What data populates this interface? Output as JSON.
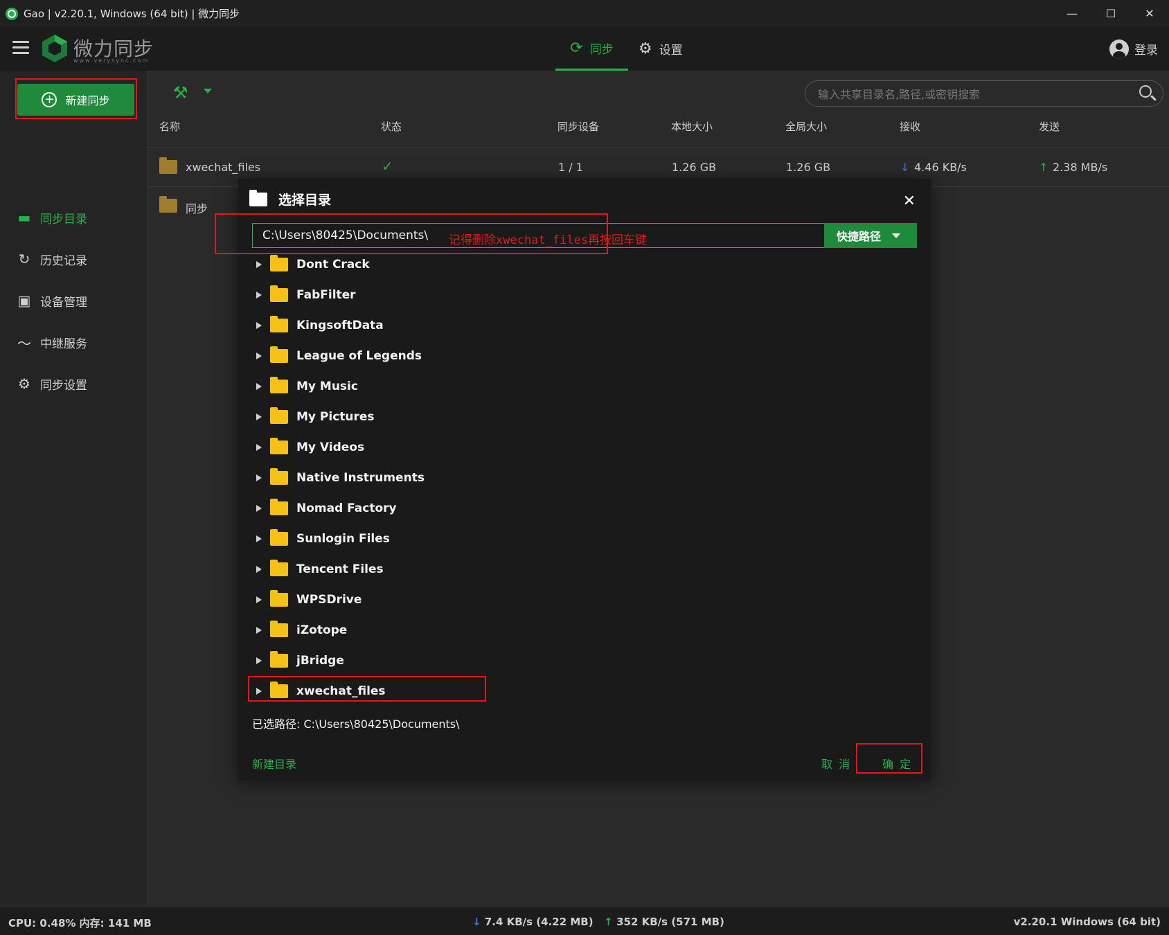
{
  "window": {
    "title": "Gao | v2.20.1, Windows (64 bit) | 微力同步",
    "minimize": "—",
    "maximize": "☐",
    "close": "✕"
  },
  "header": {
    "logo_text": "微力同步",
    "logo_sub": "www.verysync.com",
    "tab_sync": "同步",
    "tab_settings": "设置",
    "login": "登录"
  },
  "sidebar": {
    "new_sync": "新建同步",
    "items": [
      {
        "label": "同步目录",
        "icon": "folder-icon",
        "active": true
      },
      {
        "label": "历史记录",
        "icon": "history-icon",
        "active": false
      },
      {
        "label": "设备管理",
        "icon": "device-icon",
        "active": false
      },
      {
        "label": "中继服务",
        "icon": "relay-icon",
        "active": false
      },
      {
        "label": "同步设置",
        "icon": "gear-icon",
        "active": false
      }
    ]
  },
  "main": {
    "search_placeholder": "输入共享目录名,路径,或密钥搜索",
    "columns": {
      "name": "名称",
      "status": "状态",
      "devices": "同步设备",
      "local_size": "本地大小",
      "global_size": "全局大小",
      "receive": "接收",
      "send": "发送"
    },
    "rows": [
      {
        "name": "xwechat_files",
        "status": "✓",
        "devices": "1 / 1",
        "local_size": "1.26 GB",
        "global_size": "1.26 GB",
        "receive": "4.46 KB/s",
        "send": "2.38 MB/s"
      },
      {
        "name": "同步"
      }
    ]
  },
  "dialog": {
    "title": "选择目录",
    "path_value": "C:\\Users\\80425\\Documents\\",
    "quick_path": "快捷路径",
    "annotation": "记得删除xwechat_files再按回车键",
    "folders": [
      "Dont Crack",
      "FabFilter",
      "KingsoftData",
      "League of Legends",
      "My Music",
      "My Pictures",
      "My Videos",
      "Native Instruments",
      "Nomad Factory",
      "Sunlogin Files",
      "Tencent Files",
      "WPSDrive",
      "iZotope",
      "jBridge",
      "xwechat_files"
    ],
    "selected_path": "已选路径: C:\\Users\\80425\\Documents\\",
    "new_dir": "新建目录",
    "cancel": "取 消",
    "ok": "确 定"
  },
  "statusbar": {
    "cpu_mem": "CPU: 0.48%   内存: 141 MB",
    "down": "7.4 KB/s (4.22 MB)",
    "up": "352 KB/s (571 MB)",
    "version": "v2.20.1   Windows (64 bit)"
  },
  "colors": {
    "accent": "#27b24a",
    "highlight_box": "#e0191c"
  }
}
